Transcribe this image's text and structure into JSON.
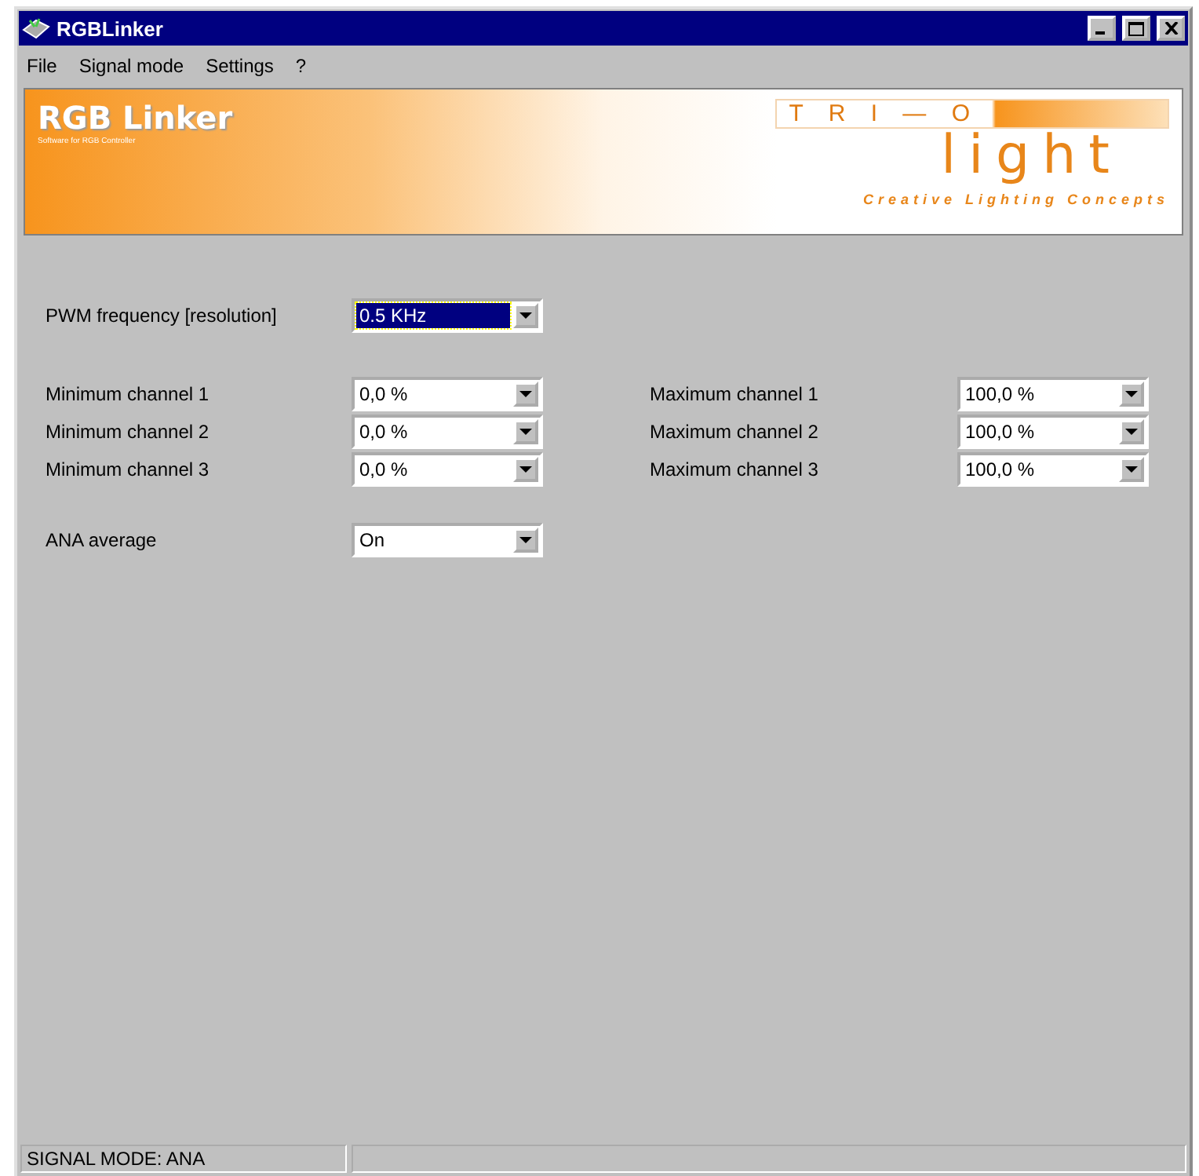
{
  "window": {
    "title": "RGBLinker"
  },
  "menu": [
    "File",
    "Signal mode",
    "Settings",
    "?"
  ],
  "banner": {
    "title": "RGB Linker",
    "subtitle": "Software for RGB Controller",
    "brand_top": "T R I — O",
    "brand": "light",
    "tagline": "Creative Lighting Concepts"
  },
  "pwm": {
    "label": "PWM frequency [resolution]",
    "value": "0.5 KHz",
    "focused": true
  },
  "minimums": [
    {
      "label": "Minimum channel 1",
      "value": "0,0 %",
      "focused": false
    },
    {
      "label": "Minimum channel 2",
      "value": "0,0 %",
      "focused": false
    },
    {
      "label": "Minimum channel 3",
      "value": "0,0 %",
      "focused": false
    }
  ],
  "maximums": [
    {
      "label": "Maximum channel 1",
      "value": "100,0 %",
      "focused": false
    },
    {
      "label": "Maximum channel 2",
      "value": "100,0 %",
      "focused": false
    },
    {
      "label": "Maximum channel 3",
      "value": "100,0 %",
      "focused": false
    }
  ],
  "ana": {
    "label": "ANA average",
    "value": "On",
    "focused": false
  },
  "status_bar": [
    "SIGNAL MODE: ANA"
  ]
}
